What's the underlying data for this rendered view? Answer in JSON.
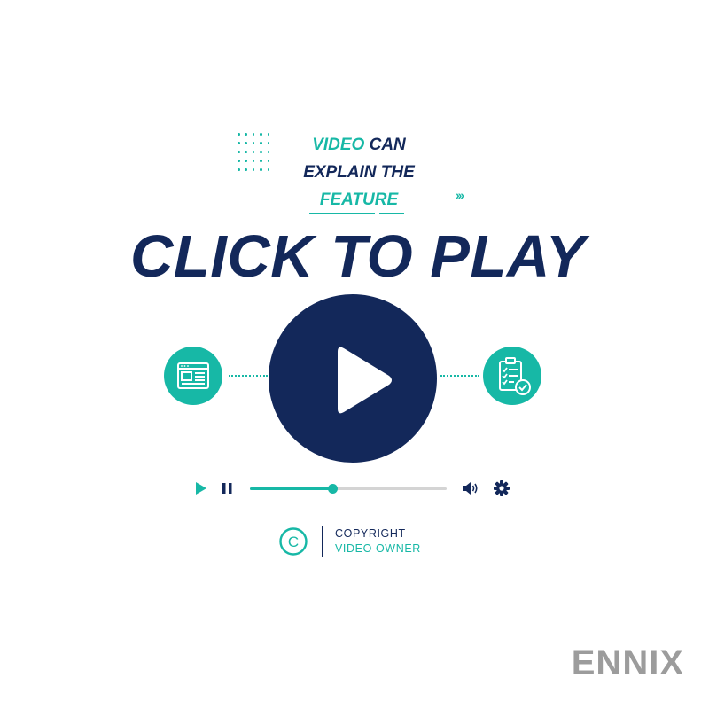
{
  "tagline": {
    "line1_accent": "VIDEO",
    "line1_rest": " CAN",
    "line2": "EXPLAIN THE",
    "line3": "FEATURE"
  },
  "headline": "CLICK TO PLAY",
  "chevrons": "›››",
  "player": {
    "progress": 0.42
  },
  "copyright": {
    "symbol": "C",
    "line1": "COPYRIGHT",
    "line2": "VIDEO OWNER"
  },
  "watermark": "ENNIX",
  "colors": {
    "navy": "#13285a",
    "teal": "#17b8a6",
    "track": "#d4d4d4"
  },
  "icons": {
    "left": "browser-layout-icon",
    "right": "clipboard-checklist-icon"
  }
}
